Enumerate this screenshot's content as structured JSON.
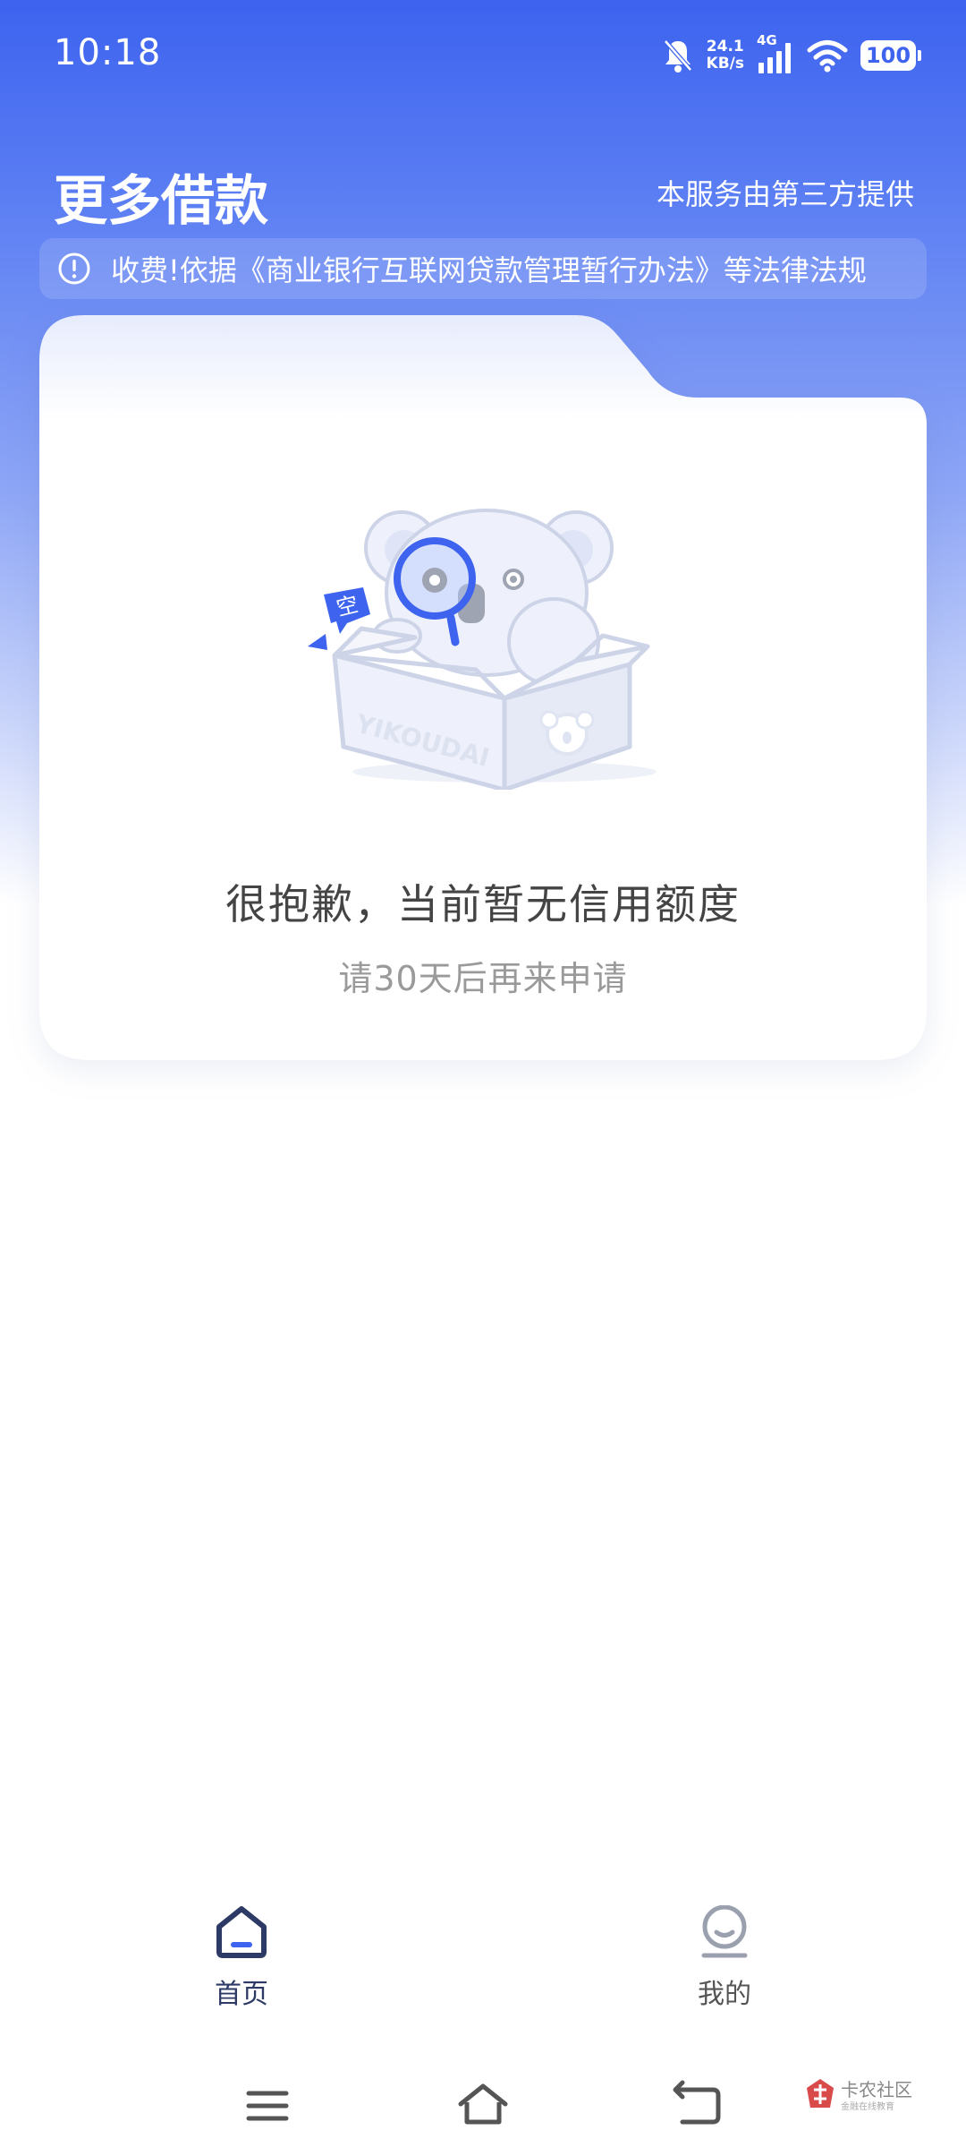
{
  "status_bar": {
    "time": "10:18",
    "net_speed_value": "24.1",
    "net_speed_unit": "KB/s",
    "network": "4G",
    "battery": "100",
    "icons": [
      "bell-muted-icon",
      "signal-icon",
      "wifi-icon",
      "battery-icon"
    ]
  },
  "header": {
    "title": "更多借款",
    "provider_note": "本服务由第三方提供"
  },
  "notice": {
    "icon": "info-circle-icon",
    "text": "收费!依据《商业银行互联网贷款管理暂行办法》等法律法规"
  },
  "empty_state": {
    "illustration": "koala-in-box-illustration",
    "bubble_text": "空",
    "box_text": "YIKOUDAI",
    "title": "很抱歉，当前暂无信用额度",
    "subtitle": "请30天后再来申请"
  },
  "tabs": [
    {
      "label": "首页",
      "icon": "home-icon",
      "active": true
    },
    {
      "label": "我的",
      "icon": "profile-icon",
      "active": false
    }
  ],
  "system_nav": [
    "menu-icon",
    "home-nav-icon",
    "back-icon"
  ],
  "watermark": {
    "text": "卡农社区",
    "sub": "金融在线教育"
  },
  "colors": {
    "brand_blue": "#3d63ef",
    "tab_active": "#2d3a66",
    "text_muted": "#9a9a9a"
  }
}
